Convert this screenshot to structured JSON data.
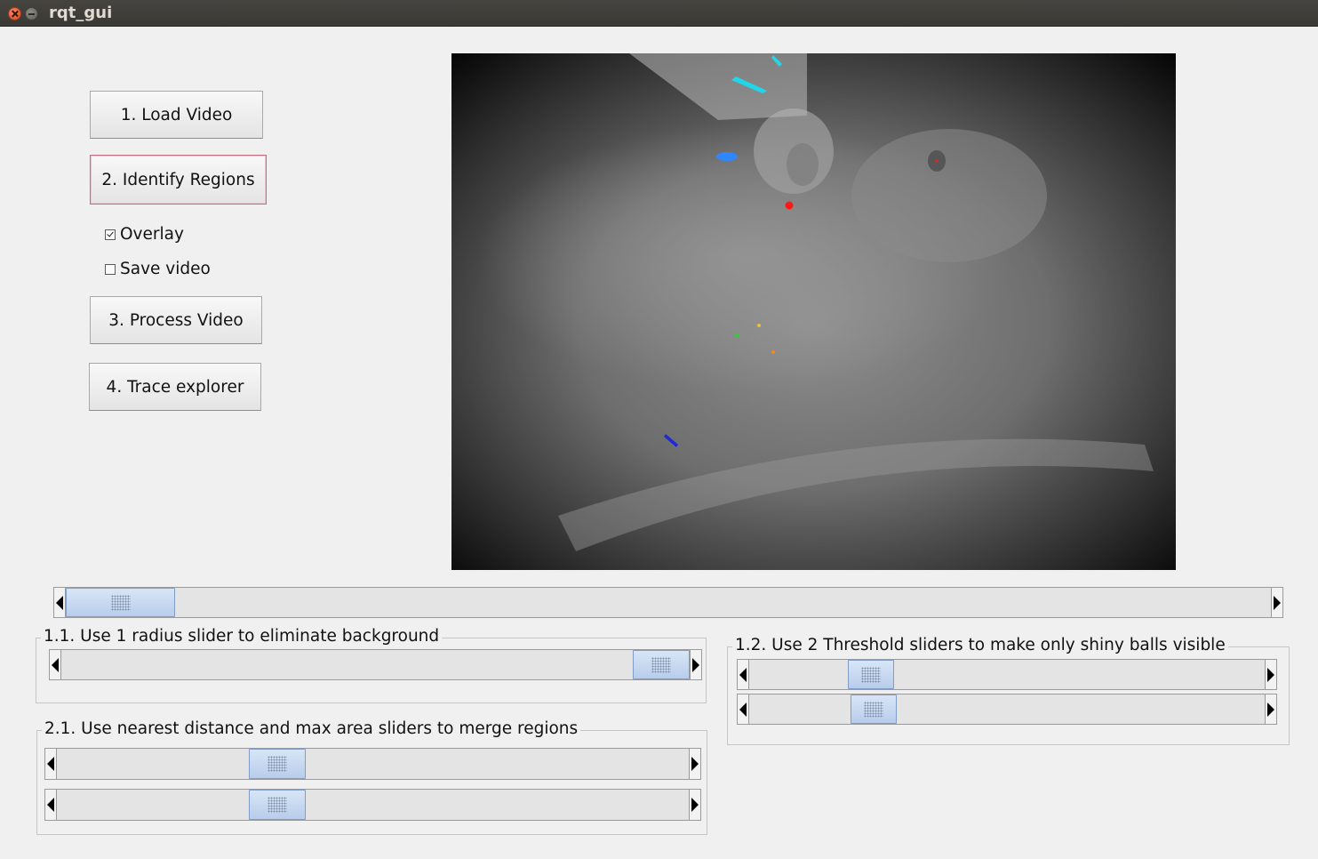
{
  "window": {
    "title": "rqt_gui"
  },
  "buttons": {
    "load_video": "1. Load Video",
    "identify_regions": "2. Identify Regions",
    "process_video": "3. Process Video",
    "trace_explorer": "4. Trace explorer"
  },
  "checkboxes": {
    "overlay": {
      "label": "Overlay",
      "checked": true
    },
    "save_video": {
      "label": "Save video",
      "checked": false
    }
  },
  "frame_slider": {
    "value_fraction": 0.05
  },
  "groups": {
    "radius": {
      "title": "1.1. Use 1 radius slider to eliminate background",
      "sliders": [
        {
          "name": "radius-slider",
          "value_fraction": 1.0
        }
      ]
    },
    "threshold": {
      "title": "1.2. Use 2 Threshold sliders to make only shiny balls visible",
      "sliders": [
        {
          "name": "threshold-low-slider",
          "value_fraction": 0.21
        },
        {
          "name": "threshold-high-slider",
          "value_fraction": 0.22
        }
      ]
    },
    "merge": {
      "title": "2.1. Use nearest distance and max area sliders to merge regions",
      "sliders": [
        {
          "name": "nearest-distance-slider",
          "value_fraction": 0.33
        },
        {
          "name": "max-area-slider",
          "value_fraction": 0.33
        }
      ]
    }
  },
  "colors": {
    "thumb": "#c8d9f1",
    "marker_cyan": "#21d6e8",
    "marker_blue": "#2f86ff",
    "marker_red": "#ff1a1a",
    "marker_darkblue": "#1a2ad8"
  }
}
